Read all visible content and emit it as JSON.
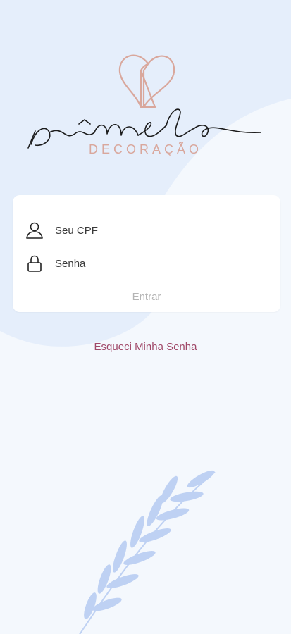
{
  "brand": {
    "name": "pâmela",
    "subtitle": "DECORAÇÃO"
  },
  "login": {
    "cpf_placeholder": "Seu CPF",
    "password_placeholder": "Senha",
    "enter_label": "Entrar"
  },
  "forgot_password": "Esqueci Minha Senha",
  "colors": {
    "background": "#f4f8fd",
    "blob": "#e5eefb",
    "brand_pink": "#d9a79c",
    "link": "#a04868",
    "leaf": "#b9cdf2"
  },
  "icons": {
    "cpf": "user-icon",
    "password": "lock-icon",
    "logo": "heart-logo-icon",
    "decoration": "leaf-branch-icon"
  }
}
